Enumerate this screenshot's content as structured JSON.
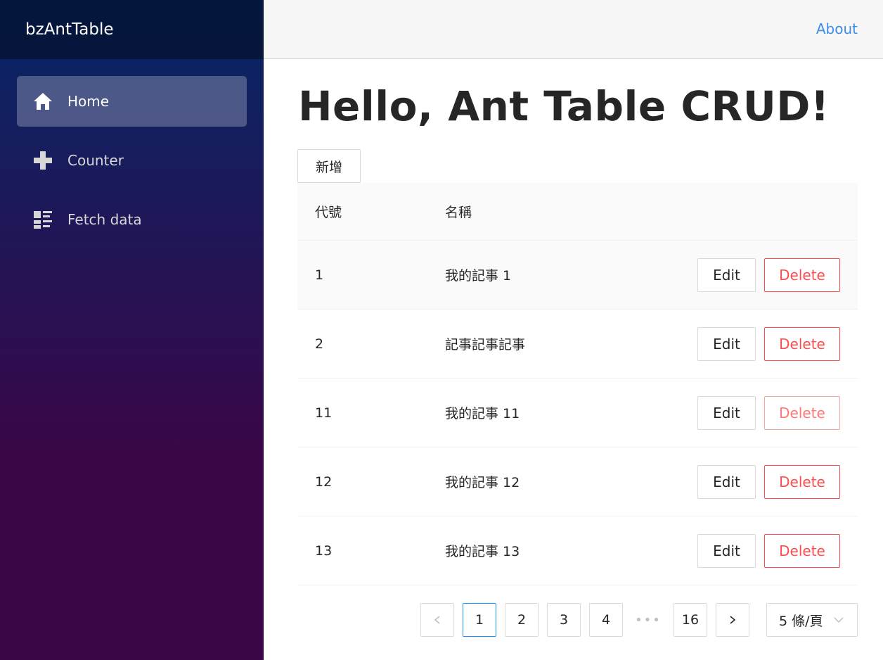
{
  "sidebar": {
    "brand": "bzAntTable",
    "items": [
      {
        "label": "Home",
        "icon": "home-icon"
      },
      {
        "label": "Counter",
        "icon": "plus-icon"
      },
      {
        "label": "Fetch data",
        "icon": "list-icon"
      }
    ]
  },
  "topbar": {
    "about": "About"
  },
  "main": {
    "title": "Hello, Ant Table CRUD!",
    "add_label": "新增",
    "table": {
      "headers": [
        "代號",
        "名稱"
      ],
      "rows": [
        {
          "id": "1",
          "name": "我的記事 1"
        },
        {
          "id": "2",
          "name": "記事記事記事"
        },
        {
          "id": "11",
          "name": "我的記事 11"
        },
        {
          "id": "12",
          "name": "我的記事 12"
        },
        {
          "id": "13",
          "name": "我的記事 13"
        }
      ],
      "edit_label": "Edit",
      "delete_label": "Delete"
    },
    "pagination": {
      "pages": [
        "1",
        "2",
        "3",
        "4"
      ],
      "ellipsis": "•••",
      "last": "16",
      "current": "1",
      "page_size": "5 條/頁"
    }
  },
  "colors": {
    "accent": "#1890ff",
    "danger": "#ff4d4f",
    "link": "#3a8ee6"
  }
}
